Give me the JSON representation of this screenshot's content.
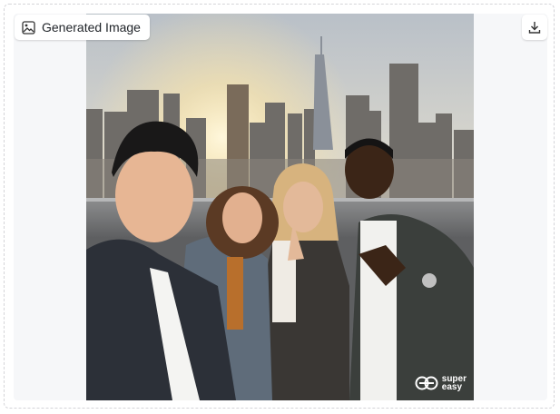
{
  "card": {
    "label": "Generated Image",
    "label_icon": "image-icon",
    "download_icon": "download-icon"
  },
  "image": {
    "alt": "Four friends taking a selfie on a rooftop at sunset with a city skyline behind them",
    "watermark": {
      "line1": "super",
      "line2": "easy"
    }
  }
}
